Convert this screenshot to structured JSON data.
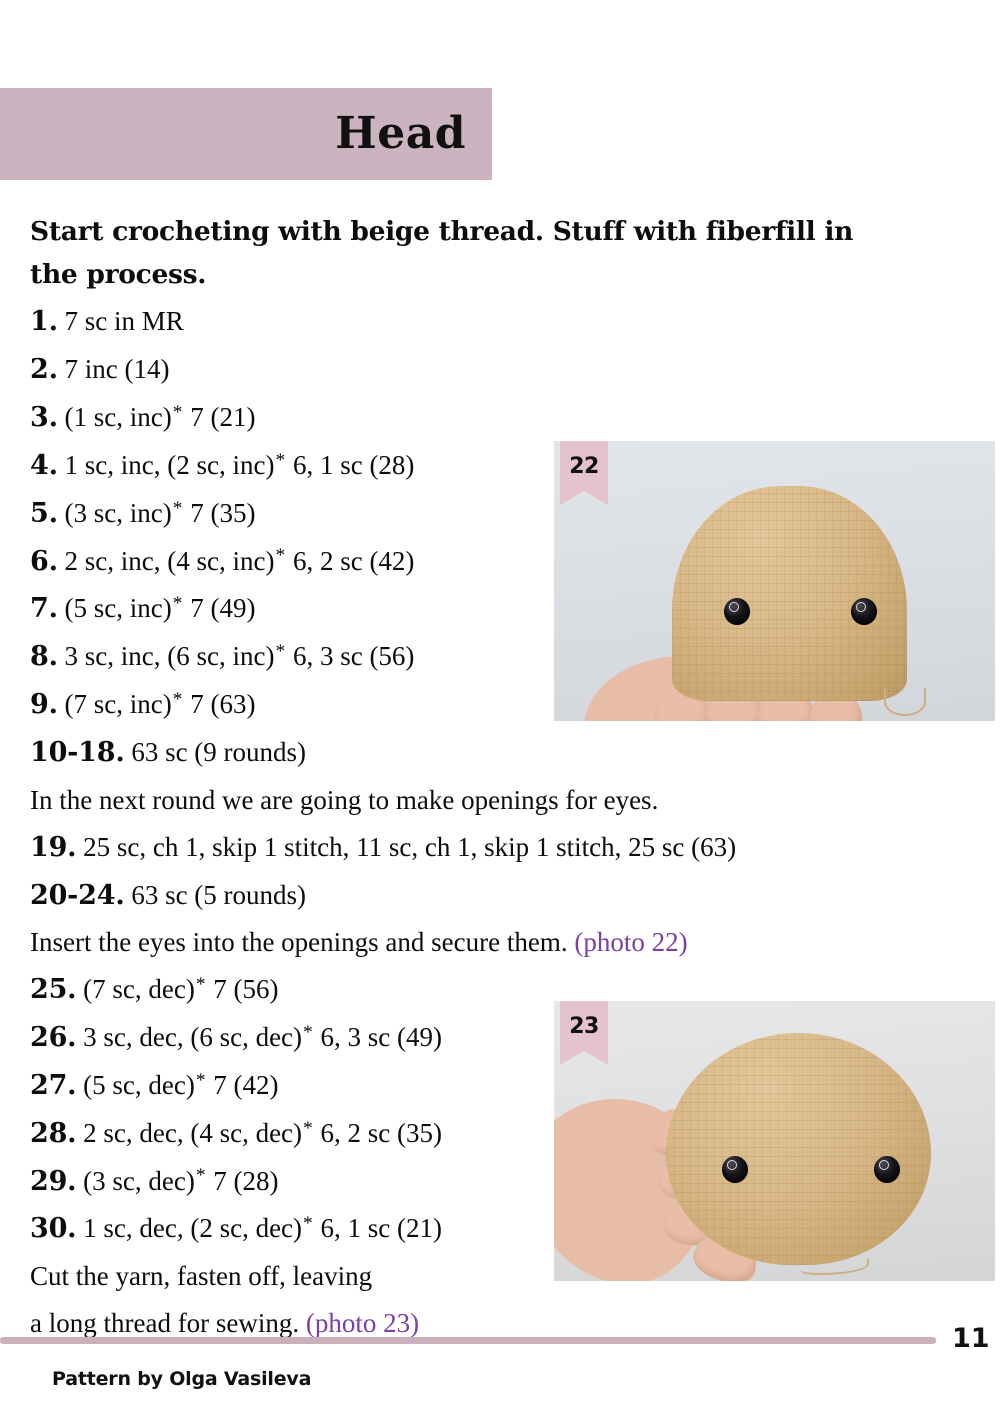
{
  "header": {
    "title": "Head",
    "band_color": "#cbb4bf"
  },
  "intro": "Start crocheting with beige thread. Stuff with fiberfill in the process.",
  "rounds": [
    {
      "num": "1.",
      "text": "7 sc in MR"
    },
    {
      "num": "2.",
      "text": "7 inc (14)"
    },
    {
      "num": "3.",
      "pre": "(1 sc, inc)",
      "post": "7 (21)"
    },
    {
      "num": "4.",
      "pre": "1 sc, inc, (2 sc, inc)",
      "post": "6, 1 sc (28)"
    },
    {
      "num": "5.",
      "pre": "(3 sc, inc)",
      "post": "7 (35)"
    },
    {
      "num": "6.",
      "pre": "2 sc, inc, (4 sc, inc)",
      "post": "6, 2 sc (42)"
    },
    {
      "num": "7.",
      "pre": "(5 sc, inc)",
      "post": "7 (49)"
    },
    {
      "num": "8.",
      "pre": "3 sc, inc, (6 sc, inc)",
      "post": "6, 3 sc (56)"
    },
    {
      "num": "9.",
      "pre": "(7 sc, inc)",
      "post": "7 (63)"
    },
    {
      "num": "10-18.",
      "text": "63 sc (9 rounds)"
    }
  ],
  "note_eyes_opening": "In the next round we are going to make openings for eyes.",
  "rounds_mid": [
    {
      "num": "19.",
      "text": "25 sc, ch 1, skip 1 stitch, 11 sc, ch 1, skip 1 stitch, 25 sc (63)"
    },
    {
      "num": "20-24.",
      "text": "63 sc (5 rounds)"
    }
  ],
  "note_insert_eyes": {
    "text": "Insert the eyes into the openings and secure them.",
    "photo_ref": "(photo 22)"
  },
  "rounds_dec": [
    {
      "num": "25.",
      "pre": "(7 sc, dec)",
      "post": "7 (56)"
    },
    {
      "num": "26.",
      "pre": "3 sc, dec, (6 sc, dec)",
      "post": "6, 3 sc (49)"
    },
    {
      "num": "27.",
      "pre": "(5 sc, dec)",
      "post": "7 (42)"
    },
    {
      "num": "28.",
      "pre": "2 sc, dec, (4 sc, dec)",
      "post": "6, 2 sc (35)"
    },
    {
      "num": "29.",
      "pre": "(3 sc, dec)",
      "post": "7 (28)"
    },
    {
      "num": "30.",
      "pre": "1 sc, dec, (2 sc, dec)",
      "post": "6, 1 sc (21)"
    }
  ],
  "closing": {
    "line1": "Cut the yarn, fasten off, leaving",
    "line2": "a long thread for sewing.",
    "photo_ref": "(photo 23)"
  },
  "photos": [
    {
      "badge": "22",
      "caption_alt": "Beige crocheted dome-shaped head with two black bead eyes held in a hand"
    },
    {
      "badge": "23",
      "caption_alt": "Finished round beige crocheted head with two black bead eyes held in a hand"
    }
  ],
  "footer": {
    "page_number": "11",
    "credit": "Pattern by Olga Vasileva",
    "rule_color": "#c9b0bb"
  },
  "colors": {
    "accent_pink": "#cbb4bf",
    "badge_pink": "#e5c3cc",
    "photo_ref_purple": "#7a3fa8",
    "text": "#0d0d0d"
  }
}
